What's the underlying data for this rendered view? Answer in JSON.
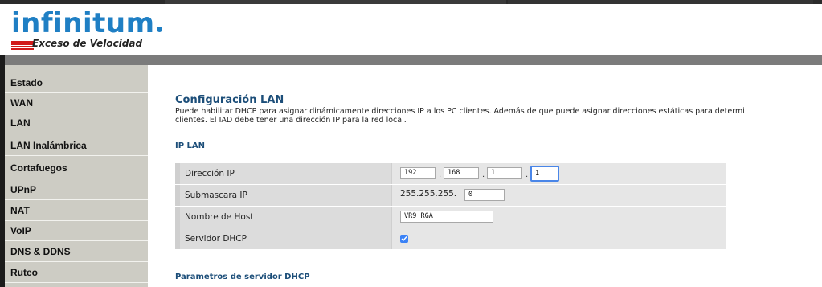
{
  "brand": {
    "logo_text": "infinitum",
    "tagline": "Exceso de Velocidad",
    "colors": {
      "logo": "#1f7fc4",
      "accent_red": "#d11a1a",
      "heading": "#1c4e79"
    }
  },
  "sidebar": {
    "items": [
      {
        "label": "Estado"
      },
      {
        "label": "WAN"
      },
      {
        "label": "LAN"
      },
      {
        "label": "LAN Inalámbrica"
      },
      {
        "label": "Cortafuegos"
      },
      {
        "label": "UPnP"
      },
      {
        "label": "NAT"
      },
      {
        "label": "VoIP"
      },
      {
        "label": "DNS & DDNS"
      },
      {
        "label": "Ruteo"
      }
    ]
  },
  "main": {
    "title": "Configuración LAN",
    "description_line1": "Puede habilitar DHCP para asignar dinámicamente direcciones IP a los PC clientes. Además de que puede asignar direcciones estáticas para determi",
    "description_line2": "clientes. El IAD debe tener una dirección IP para la red local.",
    "ip_section": "IP LAN",
    "ip_row": {
      "label": "Dirección IP",
      "octets": [
        "192",
        "168",
        "1",
        "1"
      ]
    },
    "mask_row": {
      "label": "Submascara IP",
      "prefix": "255.255.255.",
      "last_octet": "0"
    },
    "host_row": {
      "label": "Nombre de Host",
      "value": "VR9_RGA"
    },
    "dhcp_row": {
      "label": "Servidor DHCP",
      "checked": true
    },
    "dhcp_section": "Parametros de servidor DHCP",
    "octet_separator": "."
  }
}
